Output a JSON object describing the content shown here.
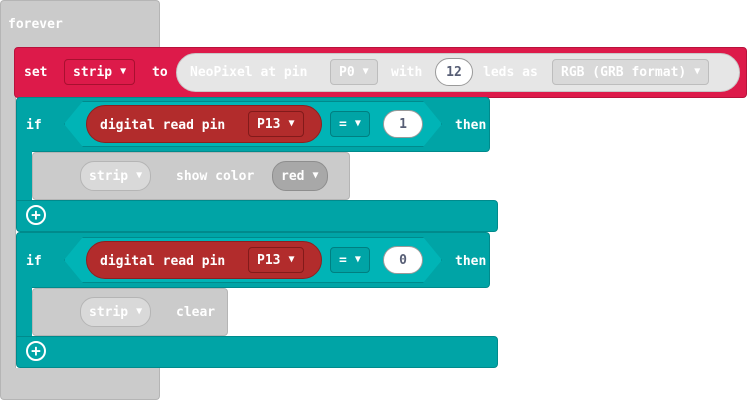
{
  "forever": {
    "label": "forever"
  },
  "set_block": {
    "label_set": "set",
    "variable": "strip",
    "label_to": "to",
    "neopixel_label": "NeoPixel at pin",
    "pin": "P0",
    "label_with": "with",
    "leds_count": "12",
    "label_leds_as": "leds as",
    "format": "RGB (GRB format)"
  },
  "if_blocks": [
    {
      "label_if": "if",
      "condition_label": "digital read pin",
      "pin": "P13",
      "operator": "=",
      "value": "1",
      "label_then": "then",
      "body": {
        "variable": "strip",
        "action": "show color",
        "color": "red"
      }
    },
    {
      "label_if": "if",
      "condition_label": "digital read pin",
      "pin": "P13",
      "operator": "=",
      "value": "0",
      "label_then": "then",
      "body": {
        "variable": "strip",
        "action": "clear"
      }
    }
  ],
  "icons": {
    "dropdown": "▼",
    "plus": "+"
  },
  "colors": {
    "forever": "#cbcbcb",
    "set_block": "#dd1a4a",
    "if_block": "#00a4a6",
    "condition": "#b22c2c",
    "statement": "#cbcbcb"
  }
}
